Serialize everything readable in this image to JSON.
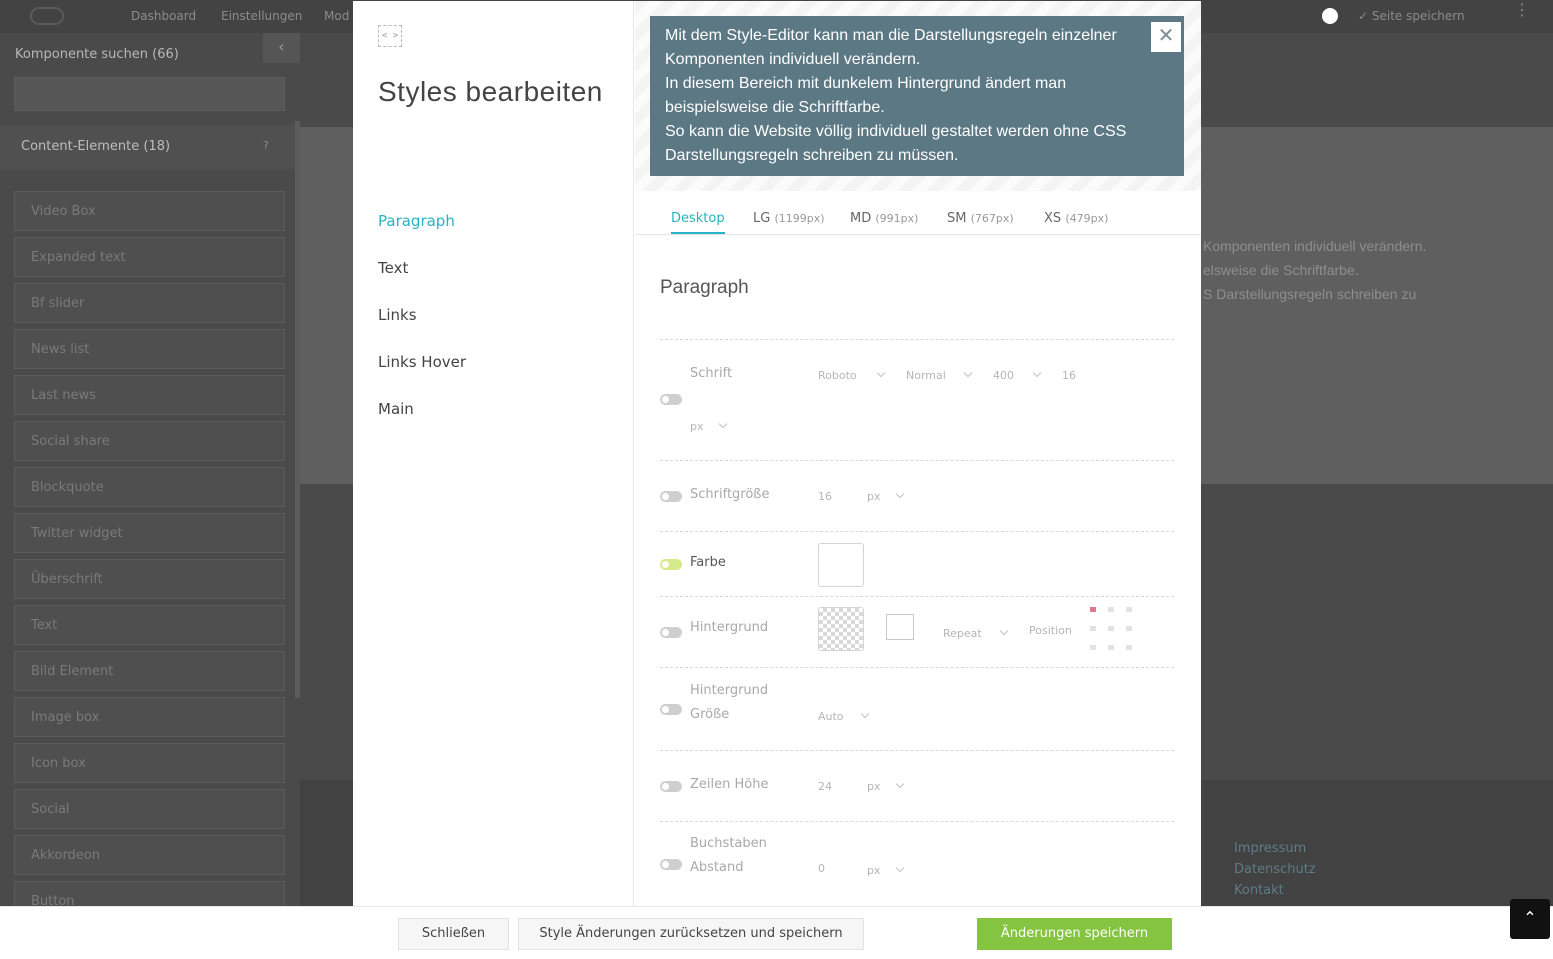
{
  "topbar": {
    "nav": [
      "Dashboard",
      "Einstellungen",
      "Mod"
    ],
    "save_label": "Seite speichern",
    "kebab": "⋮"
  },
  "sidebar": {
    "search_title": "Komponente suchen (66)",
    "collapse": "‹",
    "category_label": "Content-Elemente (18)",
    "category_help": "?",
    "items": [
      "Video Box",
      "Expanded text",
      "Bf slider",
      "News list",
      "Last news",
      "Social share",
      "Blockquote",
      "Twitter widget",
      "Überschrift",
      "Text",
      "Bild Element",
      "Image box",
      "Icon box",
      "Social",
      "Akkordeon",
      "Button"
    ]
  },
  "background": {
    "ghost_lines": [
      "Komponenten individuell verändern.",
      "elsweise die Schriftfarbe.",
      "S Darstellungsregeln schreiben zu"
    ],
    "footer_links": [
      "Impressum",
      "Datenschutz",
      "Kontakt"
    ]
  },
  "modal": {
    "code_icon": "< >",
    "title": "Styles bearbeiten",
    "nav": [
      {
        "label": "Paragraph",
        "active": true
      },
      {
        "label": "Text",
        "active": false
      },
      {
        "label": "Links",
        "active": false
      },
      {
        "label": "Links Hover",
        "active": false
      },
      {
        "label": "Main",
        "active": false
      }
    ],
    "info_lines": [
      "Mit dem Style-Editor kann man die Darstellungsregeln einzelner Komponenten individuell verändern.",
      "In diesem Bereich mit dunkelem Hintergrund ändert man beispielsweise die Schriftfarbe.",
      "So kann die Website völlig individuell gestaltet werden ohne CSS Darstellungsregeln schreiben zu müssen."
    ],
    "close_icon": "✕",
    "breakpoints": [
      {
        "label": "Desktop",
        "size": "",
        "active": true
      },
      {
        "label": "LG",
        "size": "(1199px)",
        "active": false
      },
      {
        "label": "MD",
        "size": "(991px)",
        "active": false
      },
      {
        "label": "SM",
        "size": "(767px)",
        "active": false
      },
      {
        "label": "XS",
        "size": "(479px)",
        "active": false
      }
    ],
    "section_title": "Paragraph",
    "rows": {
      "schrift": {
        "label": "Schrift",
        "family": "Roboto",
        "style": "Normal",
        "weight": "400",
        "size": "16",
        "unit": "px",
        "enabled": false
      },
      "schriftgroesse": {
        "label": "Schriftgröße",
        "value": "16",
        "unit": "px",
        "enabled": false
      },
      "farbe": {
        "label": "Farbe",
        "enabled": true
      },
      "hintergrund": {
        "label": "Hintergrund",
        "repeat": "Repeat",
        "position_label": "Position",
        "enabled": false
      },
      "hintergrund_groesse": {
        "label_1": "Hintergrund",
        "label_2": "Größe",
        "value": "Auto",
        "enabled": false
      },
      "zeilen_hoehe": {
        "label": "Zeilen Höhe",
        "value": "24",
        "unit": "px",
        "enabled": false
      },
      "buchstaben_abstand": {
        "label_1": "Buchstaben",
        "label_2": "Abstand",
        "value": "0",
        "unit": "px",
        "enabled": false
      }
    }
  },
  "footer": {
    "close_label": "Schließen",
    "reset_label": "Style Änderungen zurücksetzen und speichern",
    "save_label": "Änderungen speichern"
  },
  "scrolltop_icon": "⌃",
  "colors": {
    "accent": "#27b3c4",
    "info_bg": "#5c7884",
    "primary": "#84c441",
    "toggle_on": "#d7ea8a"
  }
}
